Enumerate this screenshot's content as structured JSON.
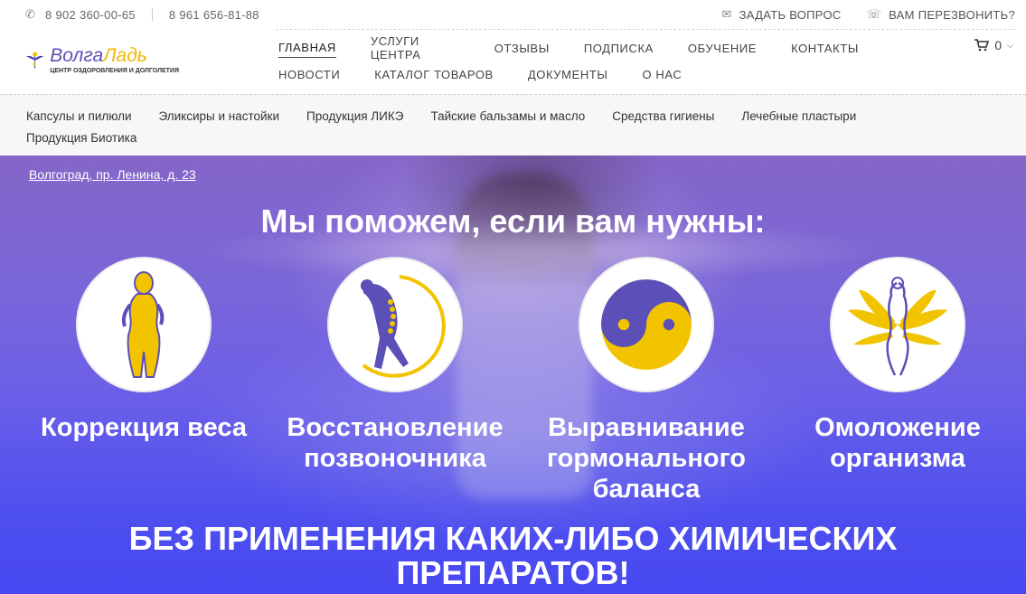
{
  "topbar": {
    "phone1": "8 902 360-00-65",
    "phone2": "8 961 656-81-88",
    "ask_question": "Задать вопрос",
    "callback": "Вам перезвонить?"
  },
  "logo": {
    "name_part1": "Волга",
    "name_part2": "Ладь",
    "subtitle": "ЦЕНТР ОЗДОРОВЛЕНИЯ И ДОЛГОЛЕТИЯ"
  },
  "nav": {
    "row1": [
      "Главная",
      "Услуги центра",
      "Отзывы",
      "Подписка",
      "Обучение",
      "Контакты"
    ],
    "row2": [
      "Новости",
      "Каталог товаров",
      "Документы",
      "О нас"
    ],
    "active": "Главная"
  },
  "cart": {
    "count": "0"
  },
  "categories": {
    "row1": [
      "Капсулы и пилюли",
      "Эликсиры и настойки",
      "Продукция ЛИКЭ",
      "Тайские бальзамы и масло",
      "Средства гигиены",
      "Лечебные пластыри"
    ],
    "row2": [
      "Продукция Биотика"
    ]
  },
  "hero": {
    "address": "Волгоград, пр. Ленина, д. 23",
    "title": "Мы поможем, если вам нужны:",
    "features": [
      {
        "label_line1": "Коррекция веса",
        "label_line2": "",
        "label_line3": "",
        "icon": "body-silhouette-icon"
      },
      {
        "label_line1": "Восстановление",
        "label_line2": "позвоночника",
        "label_line3": "",
        "icon": "spine-icon"
      },
      {
        "label_line1": "Выравнивание",
        "label_line2": "гормонального",
        "label_line3": "баланса",
        "icon": "yin-yang-icon"
      },
      {
        "label_line1": "Омоложение",
        "label_line2": "организма",
        "label_line3": "",
        "icon": "lotus-woman-icon"
      }
    ],
    "bottom_line1": "Без применения каких-либо химических",
    "bottom_line2": "препаратов!"
  },
  "colors": {
    "brand_purple": "#5b4fb8",
    "brand_yellow": "#f2c400",
    "hero_blue": "#4f50ef"
  }
}
